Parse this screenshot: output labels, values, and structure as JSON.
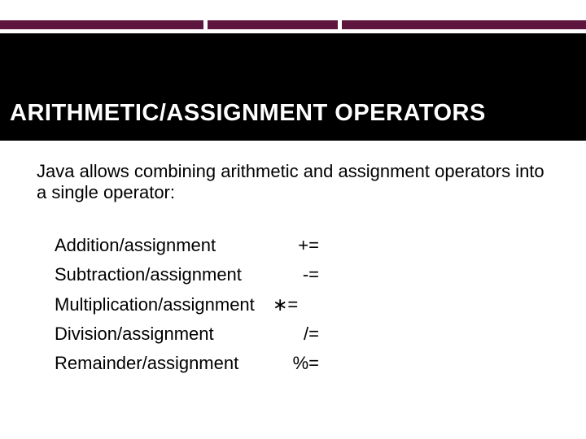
{
  "colors": {
    "accent": "#5e163f",
    "band": "#000000",
    "title_text": "#ffffff"
  },
  "title": "ARITHMETIC/ASSIGNMENT OPERATORS",
  "intro": "Java allows combining arithmetic and assignment operators into a single operator:",
  "operators": [
    {
      "label": "Addition/assignment",
      "symbol": "+="
    },
    {
      "label": "Subtraction/assignment",
      "symbol": "-="
    },
    {
      "label": "Multiplication/assignment",
      "symbol": "∗="
    },
    {
      "label": "Division/assignment",
      "symbol": "/="
    },
    {
      "label": "Remainder/assignment",
      "symbol": "%="
    }
  ]
}
